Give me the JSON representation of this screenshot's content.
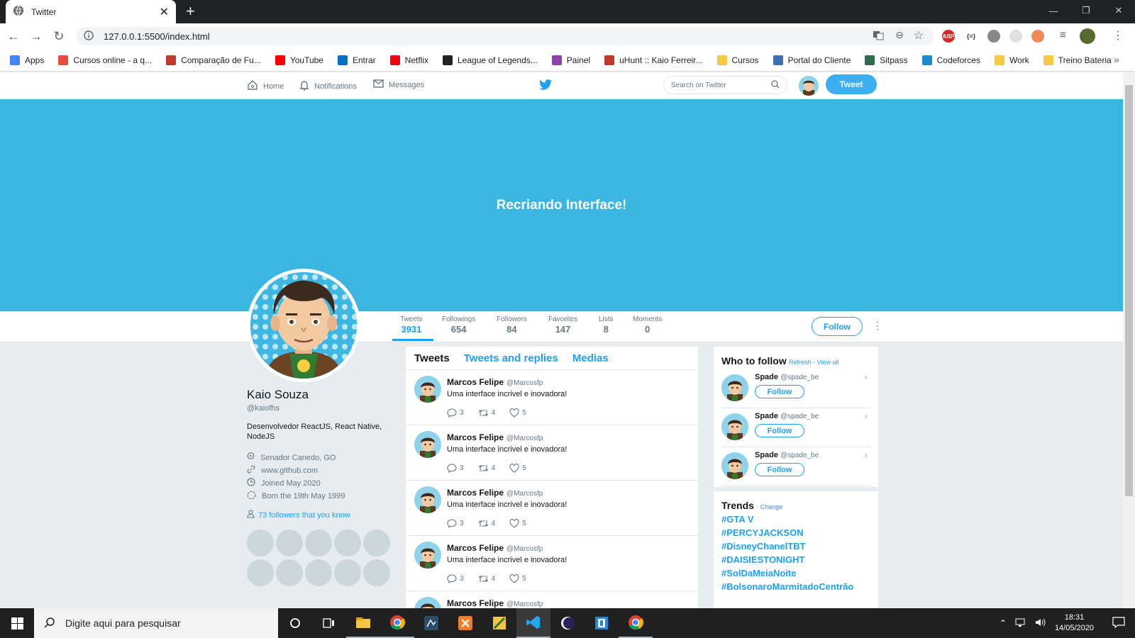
{
  "browser": {
    "tab_title": "Twitter",
    "url": "127.0.0.1:5500/index.html",
    "bookmarks": [
      "Apps",
      "Cursos online - a q...",
      "Comparação de Fu...",
      "YouTube",
      "Entrar",
      "Netflix",
      "League of Legends...",
      "Painel",
      "uHunt :: Kaio Ferreir...",
      "Cursos",
      "Portal do Cliente",
      "Sitpass",
      "Codeforces",
      "Work",
      "Treino Bateria"
    ],
    "bookmark_colors": [
      "#4285f4",
      "#e74c3c",
      "#c0392b",
      "#ff0000",
      "#0072c6",
      "#e50914",
      "#222222",
      "#8e44ad",
      "#c0392b",
      "#f6c945",
      "#3a6fb0",
      "#2c6e49",
      "#1f8acb",
      "#f6c945",
      "#f6c945"
    ],
    "abp_label": "ABP",
    "json_ext_label": "{≡}"
  },
  "twitter_nav": {
    "home": "Home",
    "notifications": "Notifications",
    "messages": "Messages",
    "search_placeholder": "Search on Twitter",
    "tweet_button": "Tweet"
  },
  "banner_text": "Recriando Interface!",
  "stats": [
    {
      "label": "Tweets",
      "value": "3931"
    },
    {
      "label": "Followings",
      "value": "654"
    },
    {
      "label": "Followers",
      "value": "84"
    },
    {
      "label": "Favorites",
      "value": "147"
    },
    {
      "label": "Lists",
      "value": "8"
    },
    {
      "label": "Moments",
      "value": "0"
    }
  ],
  "follow_button": "Follow",
  "profile": {
    "name": "Kaio Souza",
    "handle": "@kaiofhs",
    "bio": "Desenvolvedor ReactJS, React Native, NodeJS",
    "location": "Senador Canedo, GO",
    "website": "www.github.com",
    "joined": "Joined May 2020",
    "born": "Born the 19th May 1999",
    "followers_known": "73 followers that you know"
  },
  "feed": {
    "tabs": [
      "Tweets",
      "Tweets and replies",
      "Medias"
    ],
    "tweets": [
      {
        "name": "Marcos Felipe",
        "handle": "@Marcosfp",
        "text": "Uma interface incrivel e inovadora!",
        "replies": "3",
        "retweets": "4",
        "likes": "5"
      },
      {
        "name": "Marcos Felipe",
        "handle": "@Marcosfp",
        "text": "Uma interface incrivel e inovadora!",
        "replies": "3",
        "retweets": "4",
        "likes": "5"
      },
      {
        "name": "Marcos Felipe",
        "handle": "@Marcosfp",
        "text": "Uma interface incrivel e inovadora!",
        "replies": "3",
        "retweets": "4",
        "likes": "5"
      },
      {
        "name": "Marcos Felipe",
        "handle": "@Marcosfp",
        "text": "Uma interface incrivel e inovadora!",
        "replies": "3",
        "retweets": "4",
        "likes": "5"
      },
      {
        "name": "Marcos Felipe",
        "handle": "@Marcosfp",
        "text": "",
        "replies": "",
        "retweets": "",
        "likes": ""
      }
    ]
  },
  "who_to_follow": {
    "title": "Who to follow",
    "refresh": "Refresh",
    "separator": " · ",
    "view_all": "View all",
    "suggestions": [
      {
        "name": "Spade",
        "handle": "@spade_be",
        "button": "Follow"
      },
      {
        "name": "Spade",
        "handle": "@spade_be",
        "button": "Follow"
      },
      {
        "name": "Spade",
        "handle": "@spade_be",
        "button": "Follow"
      }
    ]
  },
  "trends": {
    "title": "Trends",
    "change": "· Change",
    "items": [
      "#GTA V",
      "#PERCYJACKSON",
      "#DisneyChanelTBT",
      "#DAISIESTONIGHT",
      "#SolDaMeiaNoite",
      "#BolsonaroMarmitadoCentrão"
    ]
  },
  "taskbar": {
    "search_placeholder": "Digite aqui para pesquisar",
    "time": "18:31",
    "date": "14/05/2020"
  },
  "colors": {
    "accent": "#1da1f2",
    "banner": "#3bb6e1"
  }
}
